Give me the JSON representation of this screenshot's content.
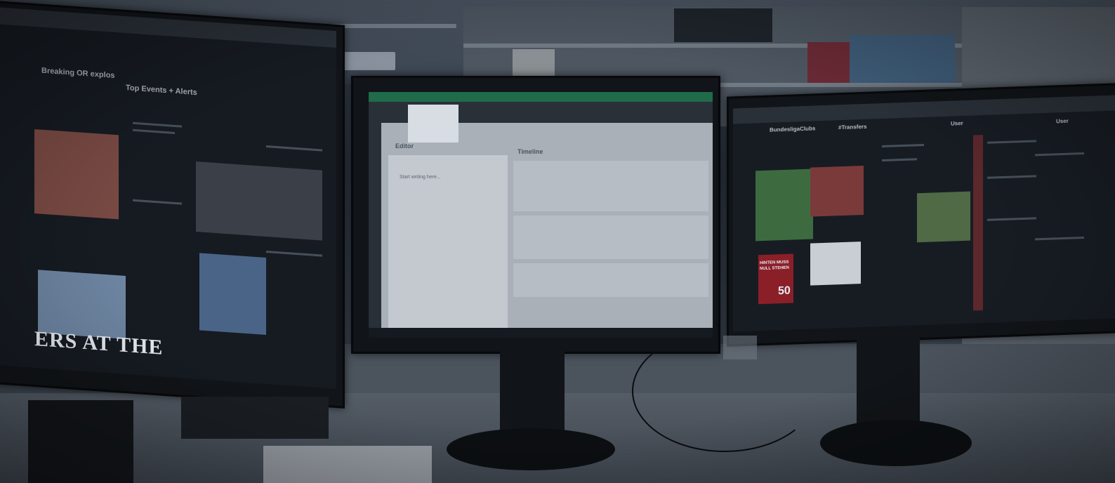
{
  "photo": {
    "subject": "Newsroom desk with three monitors showing social media dashboards",
    "left_monitor": {
      "headline_text": "ERS AT THE",
      "column_titles": [
        "Breaking OR explos",
        "Top Events + Alerts"
      ]
    },
    "center_monitor": {
      "panel_title": "Timeline",
      "editor_label": "Editor",
      "placeholder": "Start writing here..."
    },
    "right_monitor": {
      "column_titles": [
        "BundesligaClubs",
        "#Transfers",
        "User",
        "User"
      ],
      "poster_text": "HINTEN MUSS NULL STEHEN",
      "poster_number": "50"
    }
  }
}
